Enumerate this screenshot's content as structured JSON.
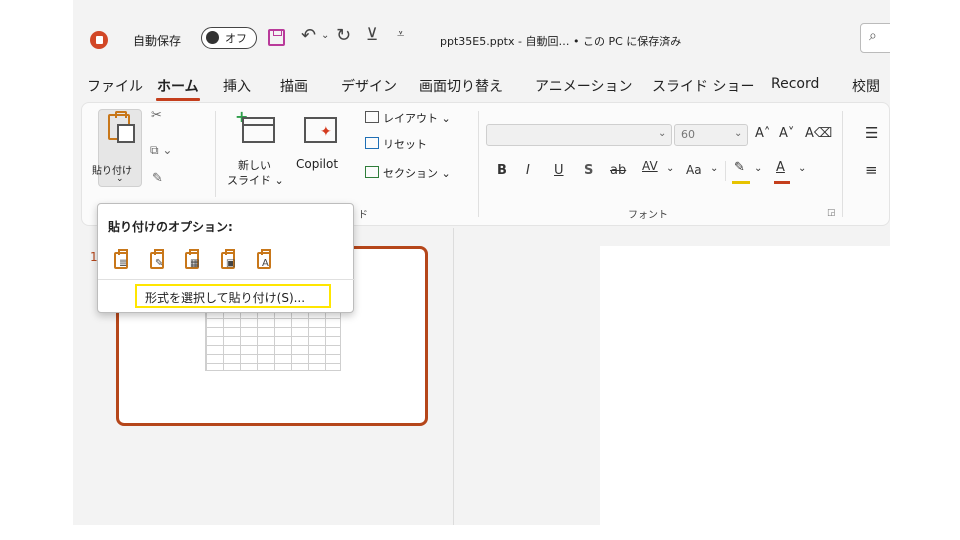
{
  "titlebar": {
    "autosave_label": "自動保存",
    "autosave_state": "オフ",
    "filename": "ppt35E5.pptx - 自動回… • この PC に保存済み",
    "accent_color": "#c43e1c"
  },
  "tabs": [
    {
      "label": "ファイル",
      "active": false
    },
    {
      "label": "ホーム",
      "active": true
    },
    {
      "label": "挿入",
      "active": false
    },
    {
      "label": "描画",
      "active": false
    },
    {
      "label": "デザイン",
      "active": false
    },
    {
      "label": "画面切り替え",
      "active": false
    },
    {
      "label": "アニメーション",
      "active": false
    },
    {
      "label": "スライド ショー",
      "active": false
    },
    {
      "label": "Record",
      "active": false
    },
    {
      "label": "校閲",
      "active": false
    }
  ],
  "ribbon": {
    "paste_label": "貼り付け",
    "new_slide_line1": "新しい",
    "new_slide_line2": "スライド ⌄",
    "copilot_label": "Copilot",
    "layout_label": "レイアウト ⌄",
    "reset_label": "リセット",
    "section_label": "セクション ⌄",
    "slides_group_label": "ド",
    "font_group_label": "フォント",
    "font_size": "60",
    "font_buttons": {
      "bold": "B",
      "italic": "I",
      "underline": "U",
      "shadow": "S",
      "strike": "ab",
      "spacing": "AV",
      "case": "Aa",
      "grow": "A",
      "shrink": "A"
    }
  },
  "paste_popup": {
    "title": "貼り付けのオプション:",
    "options": [
      "use-destination-theme",
      "keep-source-formatting",
      "embed",
      "picture",
      "keep-text-only"
    ],
    "paste_special_label": "形式を選択して貼り付け(S)...",
    "highlight_color": "#ffe600"
  },
  "slides": {
    "current_number": "1"
  }
}
